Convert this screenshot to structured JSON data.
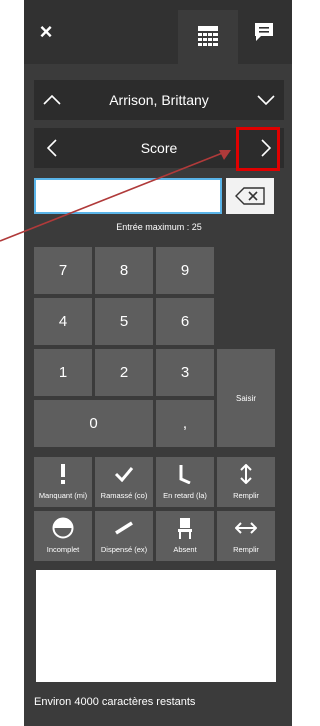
{
  "topbar": {
    "close": "×"
  },
  "student": {
    "name": "Arrison, Brittany"
  },
  "column": {
    "label": "Score"
  },
  "entry": {
    "value": "",
    "max_label": "Entrée maximum : 25"
  },
  "keypad": {
    "k7": "7",
    "k8": "8",
    "k9": "9",
    "k4": "4",
    "k5": "5",
    "k6": "6",
    "k1": "1",
    "k2": "2",
    "k3": "3",
    "k0": "0",
    "dot": ",",
    "submit": "Saisir"
  },
  "codes": {
    "missing": "Manquant (mi)",
    "collected": "Ramassé (co)",
    "late": "En retard (la)",
    "fill1": "Remplir",
    "incomplete": "Incomplet",
    "exempt": "Dispensé (ex)",
    "absent": "Absent",
    "fill2": "Remplir"
  },
  "comment": {
    "value": "",
    "remaining": "Environ 4000 caractères restants"
  },
  "colors": {
    "panel": "#3b3b3b",
    "key": "#5e5e5e",
    "highlight": "#e00000",
    "arrow": "#b03a3a"
  }
}
